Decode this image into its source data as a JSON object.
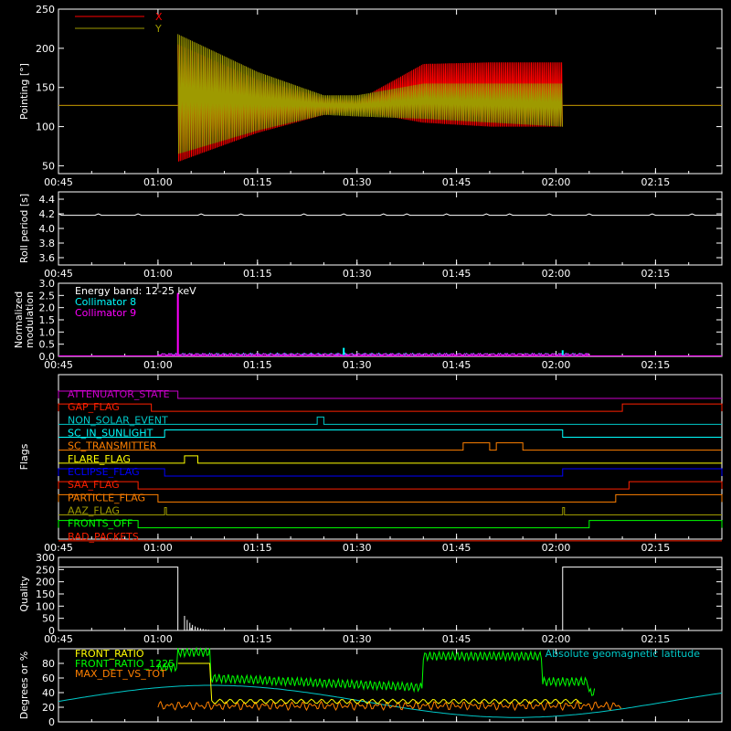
{
  "chart_data": [
    {
      "type": "line",
      "ylabel": "Pointing [°]",
      "ylim": [
        40,
        250
      ],
      "yticks": [
        50,
        100,
        150,
        200,
        250
      ],
      "xlim": [
        "00:45",
        "02:25"
      ],
      "xticks": [
        "00:45",
        "01:00",
        "01:15",
        "01:30",
        "01:45",
        "02:00",
        "02:15"
      ],
      "legend_position": "top-left",
      "series": [
        {
          "name": "X",
          "color": "#ff0000",
          "description_points": [
            {
              "t": "00:45",
              "lo": 127,
              "hi": 127
            },
            {
              "t": "01:03",
              "lo": 55,
              "hi": 205
            },
            {
              "t": "01:15",
              "lo": 92,
              "hi": 160
            },
            {
              "t": "01:25",
              "lo": 115,
              "hi": 137
            },
            {
              "t": "01:30",
              "lo": 120,
              "hi": 133
            },
            {
              "t": "01:40",
              "lo": 105,
              "hi": 180
            },
            {
              "t": "01:50",
              "lo": 100,
              "hi": 182
            },
            {
              "t": "02:01",
              "lo": 100,
              "hi": 182
            },
            {
              "t": "02:25",
              "lo": 127,
              "hi": 127
            }
          ]
        },
        {
          "name": "Y",
          "color": "#9e9a00",
          "description_points": [
            {
              "t": "00:45",
              "lo": 127,
              "hi": 127
            },
            {
              "t": "01:03",
              "lo": 65,
              "hi": 218
            },
            {
              "t": "01:15",
              "lo": 95,
              "hi": 170
            },
            {
              "t": "01:25",
              "lo": 115,
              "hi": 140
            },
            {
              "t": "01:30",
              "lo": 113,
              "hi": 140
            },
            {
              "t": "01:40",
              "lo": 110,
              "hi": 155
            },
            {
              "t": "02:01",
              "lo": 100,
              "hi": 155
            },
            {
              "t": "02:25",
              "lo": 127,
              "hi": 127
            }
          ]
        }
      ]
    },
    {
      "type": "line",
      "ylabel": "Roll period [s]",
      "ylim": [
        3.5,
        4.5
      ],
      "yticks": [
        3.6,
        3.8,
        4.0,
        4.2,
        4.4
      ],
      "xticks": [
        "00:45",
        "01:00",
        "01:15",
        "01:30",
        "01:45",
        "02:00",
        "02:15"
      ],
      "series": [
        {
          "name": "",
          "color": "#ffffff",
          "constant": 4.18
        }
      ]
    },
    {
      "type": "line",
      "ylabel": "Normalized modulation",
      "ylim": [
        0.0,
        3.0
      ],
      "yticks": [
        0.0,
        0.5,
        1.0,
        1.5,
        2.0,
        2.5,
        3.0
      ],
      "xticks": [
        "00:45",
        "01:00",
        "01:15",
        "01:30",
        "01:45",
        "02:00",
        "02:15"
      ],
      "legend": [
        "Energy band: 12-25 keV",
        "Collimator 8",
        "Collimator 9"
      ],
      "legend_colors": [
        "#ffffff",
        "#00ffff",
        "#ff00ff"
      ],
      "annotations": [
        {
          "series": "Collimator 9",
          "t": "01:03",
          "value": 2.6
        },
        {
          "series": "Collimator 8",
          "t": "01:28",
          "value": 0.35
        },
        {
          "series": "Collimator 8",
          "t": "02:01",
          "value": 0.25
        }
      ]
    },
    {
      "type": "step",
      "ylabel": "Flags",
      "xticks": [
        "00:45",
        "01:00",
        "01:15",
        "01:30",
        "01:45",
        "02:00",
        "02:15"
      ],
      "flags": [
        {
          "name": "ATTENUATOR_STATE",
          "color": "#c800c8",
          "high": [
            [
              "00:45",
              "01:03"
            ]
          ]
        },
        {
          "name": "GAP_FLAG",
          "color": "#ff2000",
          "high": [
            [
              "00:45",
              "00:59"
            ],
            [
              "02:10",
              "02:25"
            ]
          ]
        },
        {
          "name": "NON_SOLAR_EVENT",
          "color": "#00c8c8",
          "high": [
            [
              "01:24",
              "01:25"
            ]
          ]
        },
        {
          "name": "SC_IN_SUNLIGHT",
          "color": "#00ffff",
          "high": [
            [
              "01:01",
              "02:01"
            ]
          ]
        },
        {
          "name": "SC_TRANSMITTER",
          "color": "#ff8000",
          "high": [
            [
              "01:46",
              "01:50"
            ],
            [
              "01:51",
              "01:55"
            ]
          ]
        },
        {
          "name": "FLARE_FLAG",
          "color": "#ffff00",
          "high": [
            [
              "01:04",
              "01:06"
            ]
          ]
        },
        {
          "name": "ECLIPSE_FLAG",
          "color": "#0000ff",
          "high": [
            [
              "00:45",
              "01:01"
            ],
            [
              "02:01",
              "02:25"
            ]
          ]
        },
        {
          "name": "SAA_FLAG",
          "color": "#ff2000",
          "high": [
            [
              "00:45",
              "00:57"
            ],
            [
              "02:11",
              "02:25"
            ]
          ]
        },
        {
          "name": "PARTICLE_FLAG",
          "color": "#ff8000",
          "high": [
            [
              "00:45",
              "01:00"
            ],
            [
              "02:09",
              "02:25"
            ]
          ]
        },
        {
          "name": "AAZ_FLAG",
          "color": "#9e9a00",
          "high": [
            [
              "01:01",
              "01:01"
            ],
            [
              "02:01",
              "02:01"
            ]
          ]
        },
        {
          "name": "FRONTS_OFF",
          "color": "#00ff00",
          "high": [
            [
              "00:45",
              "00:57"
            ],
            [
              "02:05",
              "02:25"
            ]
          ]
        },
        {
          "name": "BAD_PACKETS",
          "color": "#ff2000",
          "high": []
        }
      ]
    },
    {
      "type": "line",
      "ylabel": "Quality",
      "ylim": [
        0,
        300
      ],
      "yticks": [
        0,
        50,
        100,
        150,
        200,
        250,
        300
      ],
      "xticks": [
        "00:45",
        "01:00",
        "01:15",
        "01:30",
        "01:45",
        "02:00",
        "02:15"
      ],
      "series": [
        {
          "name": "",
          "color": "#ffffff",
          "description_points": [
            {
              "t": "00:45",
              "v": 260
            },
            {
              "t": "01:03",
              "v": 260
            },
            {
              "t": "01:03",
              "v": 0
            },
            {
              "t": "02:01",
              "v": 0
            },
            {
              "t": "02:01",
              "v": 260
            },
            {
              "t": "02:25",
              "v": 260
            }
          ]
        }
      ]
    },
    {
      "type": "line",
      "ylabel": "Degrees or %",
      "xticks": [
        "00:45",
        "01:00",
        "01:15",
        "01:30",
        "01:45",
        "02:00",
        "02:15"
      ],
      "series": [
        {
          "name": "FRONT_RATIO",
          "color": "#ffff00"
        },
        {
          "name": "FRONT_RATIO_1225",
          "color": "#00ff00"
        },
        {
          "name": "MAX_DET_VS_TOT",
          "color": "#ff8000"
        },
        {
          "name": "Absolute geomagnetic latitude",
          "color": "#00c8c8"
        }
      ]
    }
  ]
}
